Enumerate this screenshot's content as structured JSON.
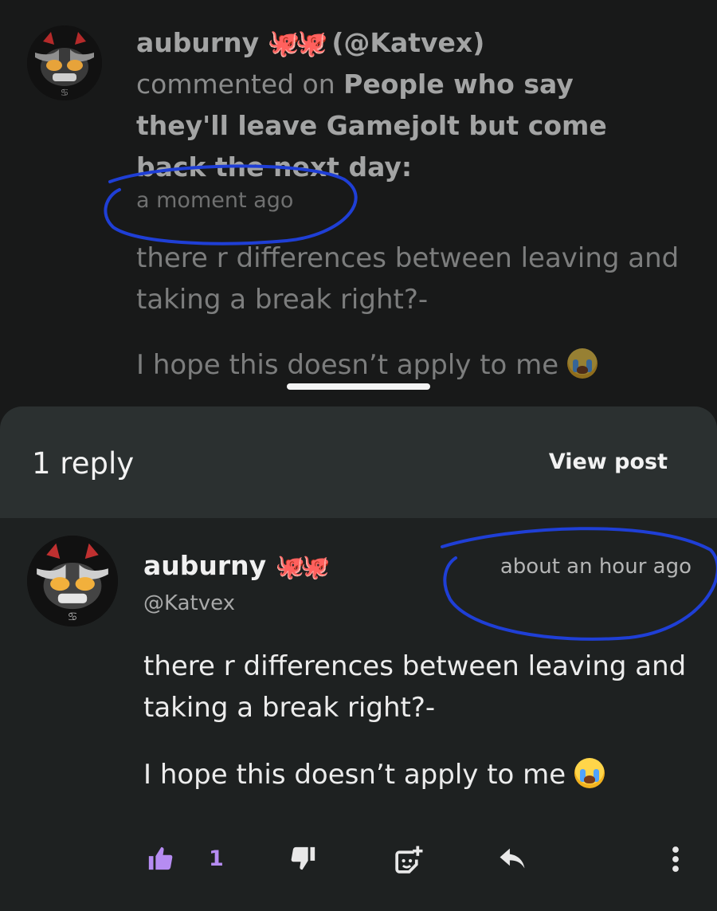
{
  "notification": {
    "username": "auburny",
    "username_emoji": "🐙🐙",
    "handle_paren": "(@Katvex)",
    "action": "commented on",
    "post_title": "People who say they'll leave Gamejolt but come back the next day:",
    "time": "a moment ago",
    "body": [
      "there r differences between leaving and taking a break right?-",
      "I hope this doesn’t apply to me"
    ],
    "emoji_name": "loudly-crying-face"
  },
  "sheet": {
    "reply_count_label": "1 reply",
    "view_post_label": "View post"
  },
  "reply": {
    "username": "auburny",
    "username_emoji": "🐙🐙",
    "handle": "@Katvex",
    "time": "about an hour ago",
    "body": [
      "there r differences between leaving and taking a break right?-",
      "I hope this doesn’t apply to me"
    ],
    "emoji_name": "loudly-crying-face",
    "like_count": "1"
  },
  "colors": {
    "accent_like": "#b68cf2",
    "pen_annotation": "#1f3fd6",
    "sheet_header": "#2b3030"
  },
  "icons": [
    "thumbs-up-icon",
    "thumbs-down-icon",
    "sticker-add-icon",
    "reply-icon",
    "more-vertical-icon"
  ]
}
